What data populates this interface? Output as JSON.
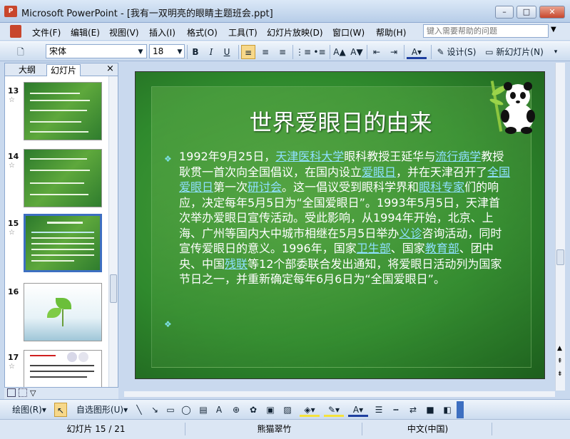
{
  "window": {
    "title": "Microsoft PowerPoint - [我有一双明亮的眼睛主题班会.ppt]",
    "icon": "powerpoint-icon"
  },
  "menu": [
    "文件(F)",
    "编辑(E)",
    "视图(V)",
    "插入(I)",
    "格式(O)",
    "工具(T)",
    "幻灯片放映(D)",
    "窗口(W)",
    "帮助(H)"
  ],
  "help_search": {
    "placeholder": "键入需要帮助的问题"
  },
  "toolbar": {
    "font": "宋体",
    "size": "18",
    "bold": "B",
    "italic": "I",
    "underline": "U",
    "design": "设计(S)",
    "new_slide": "新幻灯片(N)"
  },
  "panel": {
    "tabs": [
      "大纲",
      "幻灯片"
    ],
    "close": "×"
  },
  "thumbnails": [
    {
      "num": "13",
      "star": "☆"
    },
    {
      "num": "14",
      "star": "☆"
    },
    {
      "num": "15",
      "star": "☆"
    },
    {
      "num": "16",
      "star": ""
    },
    {
      "num": "17",
      "star": "☆"
    }
  ],
  "slide": {
    "title": "世界爱眼日的由来",
    "body": [
      {
        "t": "1992年9月25日，"
      },
      {
        "t": "天津医科大学",
        "link": true
      },
      {
        "t": "眼科教授王延华与"
      },
      {
        "t": "流行病学",
        "link": true
      },
      {
        "t": "教授耿贯一首次向全国倡议，在国内设立"
      },
      {
        "t": "爱眼日",
        "link": true
      },
      {
        "t": "，并在天津召开了"
      },
      {
        "t": "全国爱眼日",
        "link": true
      },
      {
        "t": "第一次"
      },
      {
        "t": "研讨会",
        "link": true
      },
      {
        "t": "。这一倡议受到眼科学界和"
      },
      {
        "t": "眼科专家",
        "link": true
      },
      {
        "t": "们的响应，决定每年5月5日为“全国爱眼日”。1993年5月5日，天津首次举办爱眼日宣传活动。受此影响，从1994年开始，北京、上海、广州等国内大中城市相继在5月5日举办"
      },
      {
        "t": "义诊",
        "link": true
      },
      {
        "t": "咨询活动，同时宣传爱眼日的意义。1996年，国家"
      },
      {
        "t": "卫生部",
        "link": true
      },
      {
        "t": "、国家"
      },
      {
        "t": "教育部",
        "link": true
      },
      {
        "t": "、团中央、中国"
      },
      {
        "t": "残联",
        "link": true
      },
      {
        "t": "等12个部委联合发出通知，将爱眼日活动列为国家节日之一，并重新确定每年6月6日为“全国爱眼日”。"
      }
    ]
  },
  "drawing_toolbar": {
    "draw": "绘图(R)",
    "autoshapes": "自选图形(U)"
  },
  "status": {
    "slide": "幻灯片 15 / 21",
    "design": "熊猫翠竹",
    "language": "中文(中国)"
  }
}
